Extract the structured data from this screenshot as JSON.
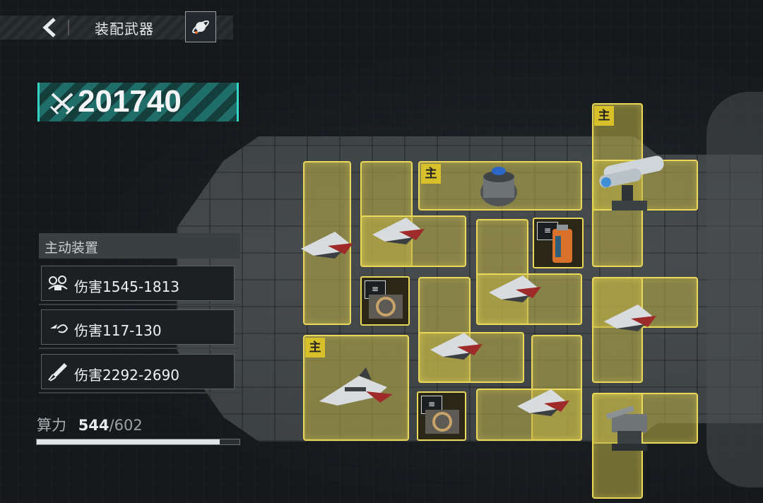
{
  "header": {
    "title": "装配武器"
  },
  "power_score": "201740",
  "active_devices": {
    "heading": "主动装置",
    "items": [
      {
        "icon": "drone-swarm-icon",
        "label": "伤害1545-1813"
      },
      {
        "icon": "drone-return-icon",
        "label": "伤害117-130"
      },
      {
        "icon": "missile-icon",
        "label": "伤害2292-2690"
      }
    ]
  },
  "compute": {
    "label": "算力",
    "current": "544",
    "max": "/602",
    "fraction": 0.9037
  },
  "slots": {
    "main_tag": "主",
    "module_signal": "≡"
  },
  "colors": {
    "slot": "#e9d85a",
    "accent": "#33d6c4",
    "main_tag": "#d8c02a"
  }
}
